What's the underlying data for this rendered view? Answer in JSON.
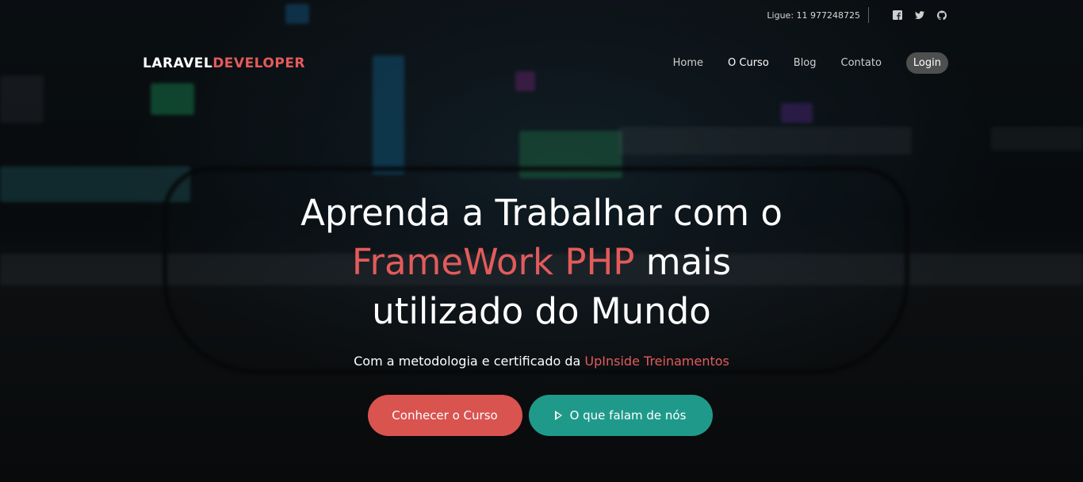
{
  "topbar": {
    "phone": "Ligue: 11 977248725",
    "social": [
      "facebook-icon",
      "twitter-icon",
      "github-icon"
    ]
  },
  "logo": {
    "part1": "LARAVEL",
    "part2": "DEVELOPER"
  },
  "nav": {
    "items": [
      "Home",
      "O Curso",
      "Blog",
      "Contato"
    ],
    "active": "O Curso",
    "login": "Login"
  },
  "hero": {
    "headline_line1": "Aprenda a Trabalhar com o",
    "headline_highlight": "FrameWork PHP",
    "headline_after_highlight": " mais",
    "headline_line3": "utilizado do Mundo",
    "subline_prefix": "Com a metodologia e certificado da ",
    "subline_highlight": "UpInside Treinamentos"
  },
  "buttons": {
    "primary": "Conhecer o Curso",
    "secondary": "O que falam de nós"
  },
  "colors": {
    "accent": "#e35b5b",
    "primary_button": "#d9534f",
    "secondary_button": "#1f9a8a"
  }
}
